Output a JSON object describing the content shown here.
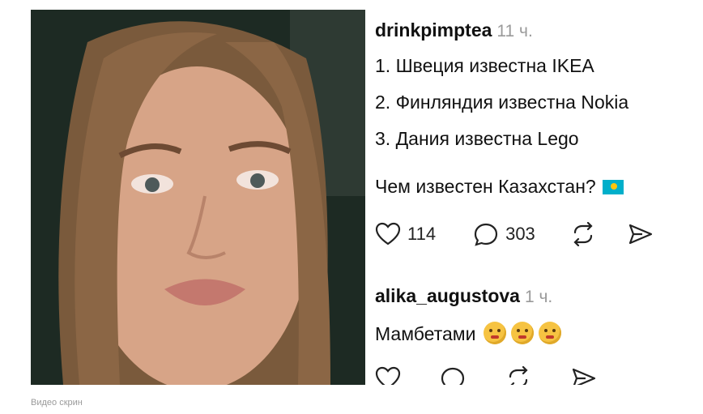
{
  "post": {
    "author": "drinkpimptea",
    "time": "11 ч.",
    "lines": [
      "1. Швеция известна IKEA",
      "2. Финляндия известна Nokia",
      "3. Дания известна Lego"
    ],
    "question": "Чем известен Казахстан?",
    "likes": "114",
    "replies": "303"
  },
  "reply": {
    "author": "alika_augustova",
    "time": "1 ч.",
    "text": "Мамбетами"
  },
  "caption": "Видео скрин",
  "icons": {
    "like": "heart-icon",
    "comment": "comment-bubble-icon",
    "repost": "repost-icon",
    "share": "send-icon",
    "flag": "kazakhstan-flag-emoji",
    "emoji": "melting-face-emoji"
  },
  "colors": {
    "time": "#9a9a9a",
    "caption": "#9a9a9a",
    "flag_blue": "#00afca",
    "flag_sun": "#fec50c"
  }
}
